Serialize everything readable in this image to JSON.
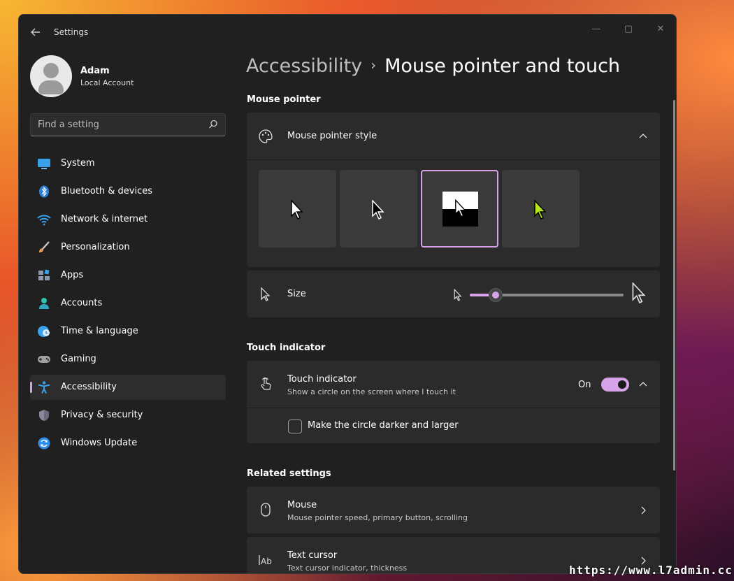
{
  "window": {
    "app_title": "Settings",
    "controls": {
      "minimize": "—",
      "maximize": "▢",
      "close": "✕"
    }
  },
  "profile": {
    "name": "Adam",
    "account_type": "Local Account"
  },
  "search": {
    "placeholder": "Find a setting",
    "icon": "search-icon"
  },
  "nav": {
    "items": [
      {
        "label": "System",
        "icon": "system-icon",
        "color": "#3aa0e8"
      },
      {
        "label": "Bluetooth & devices",
        "icon": "bluetooth-icon",
        "color": "#3a8ee8"
      },
      {
        "label": "Network & internet",
        "icon": "wifi-icon",
        "color": "#3aa0e8"
      },
      {
        "label": "Personalization",
        "icon": "brush-icon",
        "color": "#e8a05a"
      },
      {
        "label": "Apps",
        "icon": "apps-icon",
        "color": "#8a9ab0"
      },
      {
        "label": "Accounts",
        "icon": "accounts-icon",
        "color": "#2fc2b0"
      },
      {
        "label": "Time & language",
        "icon": "globe-clock-icon",
        "color": "#3aa0e8"
      },
      {
        "label": "Gaming",
        "icon": "gamepad-icon",
        "color": "#9a9a9a"
      },
      {
        "label": "Accessibility",
        "icon": "accessibility-icon",
        "color": "#3aa0e8"
      },
      {
        "label": "Privacy & security",
        "icon": "shield-icon",
        "color": "#8a8a9a"
      },
      {
        "label": "Windows Update",
        "icon": "update-icon",
        "color": "#2f8ee8"
      }
    ],
    "active_index": 8
  },
  "breadcrumb": {
    "parent": "Accessibility",
    "separator": "›",
    "current": "Mouse pointer and touch"
  },
  "mouse_pointer": {
    "section_title": "Mouse pointer",
    "style_label": "Mouse pointer style",
    "styles": [
      {
        "name": "white",
        "selected": false
      },
      {
        "name": "black",
        "selected": false
      },
      {
        "name": "inverted",
        "selected": true
      },
      {
        "name": "custom",
        "selected": false,
        "color": "#b5e61d"
      }
    ],
    "size_label": "Size",
    "size_fraction": 0.17
  },
  "touch_indicator": {
    "section_title": "Touch indicator",
    "label": "Touch indicator",
    "description": "Show a circle on the screen where I touch it",
    "state_label": "On",
    "enabled": true,
    "darker_option": "Make the circle darker and larger",
    "darker_checked": false
  },
  "related": {
    "section_title": "Related settings",
    "items": [
      {
        "label": "Mouse",
        "description": "Mouse pointer speed, primary button, scrolling",
        "icon": "mouse-icon"
      },
      {
        "label": "Text cursor",
        "description": "Text cursor indicator, thickness",
        "icon": "text-cursor-icon"
      }
    ]
  },
  "theme": {
    "accent": "#d6a2e8",
    "window_bg": "#202020",
    "card_bg": "#2b2b2b"
  },
  "watermark": "https://www.l7admin.cc"
}
